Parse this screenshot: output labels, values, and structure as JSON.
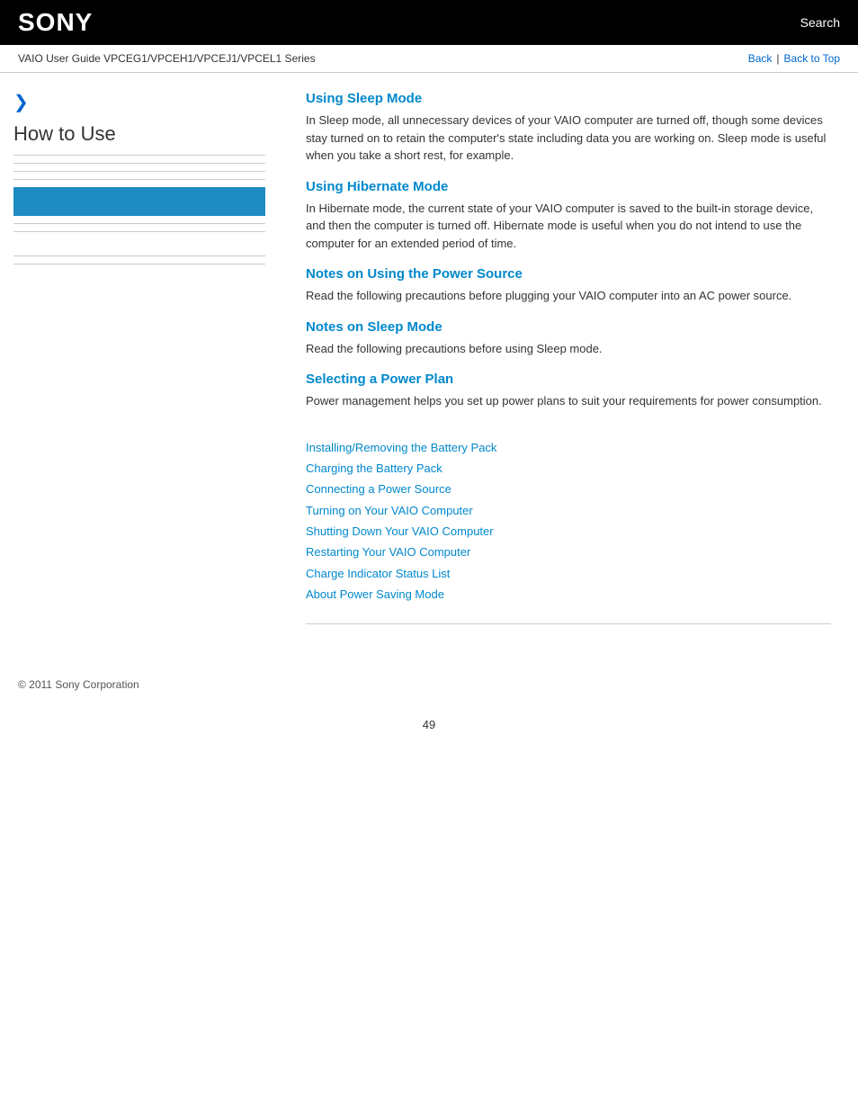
{
  "header": {
    "logo": "SONY",
    "search_label": "Search"
  },
  "breadcrumb": {
    "guide_title": "VAIO User Guide VPCEG1/VPCEH1/VPCEJ1/VPCEL1 Series",
    "back_label": "Back",
    "back_to_top_label": "Back to Top"
  },
  "sidebar": {
    "arrow": "❯",
    "title": "How to Use",
    "items": [
      {
        "label": ""
      },
      {
        "label": ""
      },
      {
        "label": ""
      },
      {
        "label": ""
      },
      {
        "label": ""
      },
      {
        "label": ""
      },
      {
        "label": ""
      },
      {
        "label": ""
      },
      {
        "label": ""
      }
    ]
  },
  "sections": [
    {
      "title": "Using Sleep Mode",
      "text": "In Sleep mode, all unnecessary devices of your VAIO computer are turned off, though some devices stay turned on to retain the computer's state including data you are working on. Sleep mode is useful when you take a short rest, for example."
    },
    {
      "title": "Using Hibernate Mode",
      "text": "In Hibernate mode, the current state of your VAIO computer is saved to the built-in storage device, and then the computer is turned off. Hibernate mode is useful when you do not intend to use the computer for an extended period of time."
    },
    {
      "title": "Notes on Using the Power Source",
      "text": "Read the following precautions before plugging your VAIO computer into an AC power source."
    },
    {
      "title": "Notes on Sleep Mode",
      "text": "Read the following precautions before using Sleep mode."
    },
    {
      "title": "Selecting a Power Plan",
      "text": "Power management helps you set up power plans to suit your requirements for power consumption."
    }
  ],
  "links": [
    {
      "label": "Installing/Removing the Battery Pack"
    },
    {
      "label": "Charging the Battery Pack"
    },
    {
      "label": "Connecting a Power Source"
    },
    {
      "label": "Turning on Your VAIO Computer"
    },
    {
      "label": "Shutting Down Your VAIO Computer"
    },
    {
      "label": "Restarting Your VAIO Computer"
    },
    {
      "label": "Charge Indicator Status List"
    },
    {
      "label": "About Power Saving Mode"
    }
  ],
  "footer": {
    "copyright": "© 2011 Sony Corporation"
  },
  "page_number": "49"
}
